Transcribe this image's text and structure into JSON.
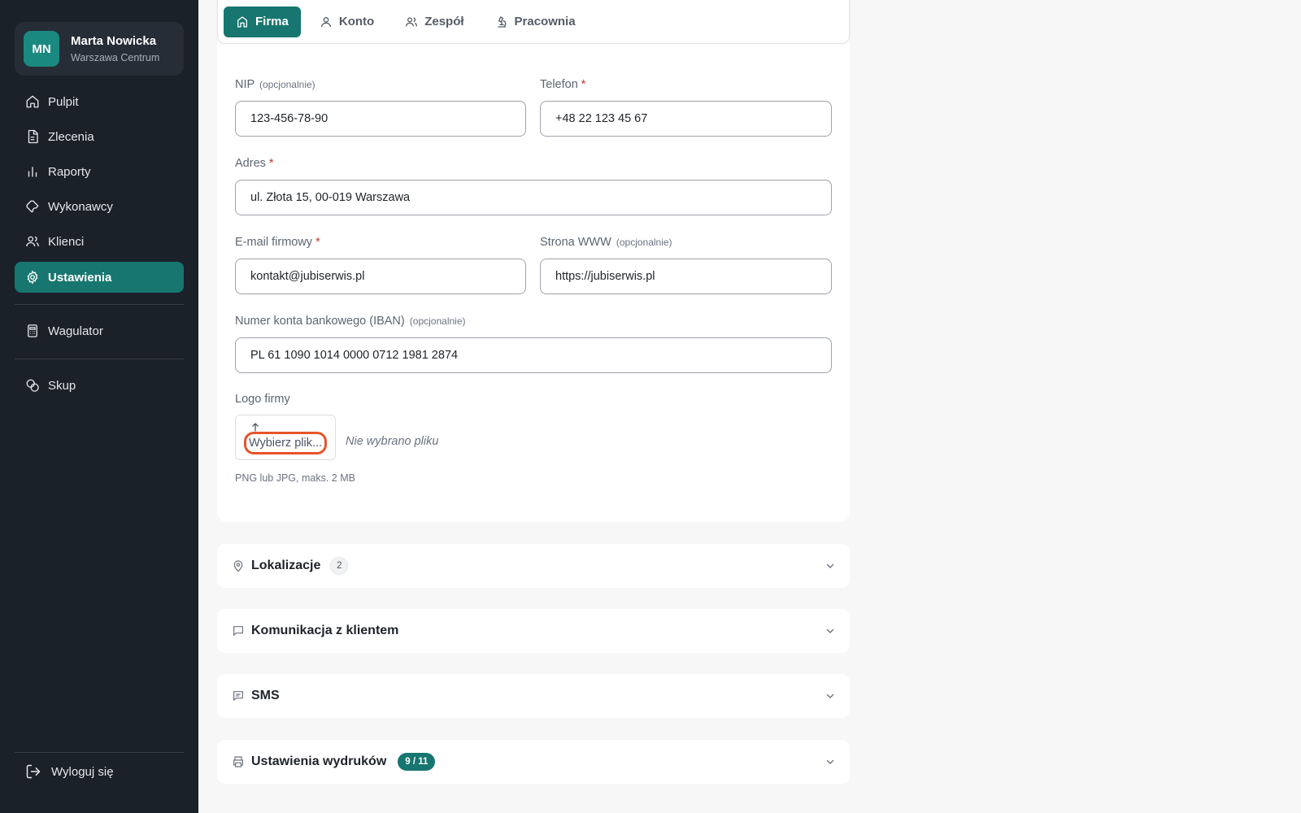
{
  "user": {
    "initials": "MN",
    "name": "Marta Nowicka",
    "location": "Warszawa Centrum"
  },
  "nav": {
    "items": [
      {
        "label": "Pulpit",
        "icon": "home-icon"
      },
      {
        "label": "Zlecenia",
        "icon": "document-icon"
      },
      {
        "label": "Raporty",
        "icon": "bar-chart-icon"
      },
      {
        "label": "Wykonawcy",
        "icon": "wrench-icon"
      },
      {
        "label": "Klienci",
        "icon": "users-icon"
      },
      {
        "label": "Ustawienia",
        "icon": "gear-icon",
        "active": true
      }
    ],
    "extra": [
      {
        "label": "Wagulator",
        "icon": "calculator-icon"
      },
      {
        "label": "Skup",
        "icon": "coins-icon"
      }
    ],
    "logout": "Wyloguj się"
  },
  "tabs": [
    {
      "label": "Firma",
      "icon": "building-icon",
      "active": true
    },
    {
      "label": "Konto",
      "icon": "user-icon"
    },
    {
      "label": "Zespół",
      "icon": "team-icon"
    },
    {
      "label": "Pracownia",
      "icon": "microscope-icon"
    }
  ],
  "form": {
    "nip": {
      "label": "NIP",
      "optional": "(opcjonalnie)",
      "value": "123-456-78-90"
    },
    "phone": {
      "label": "Telefon",
      "required": "*",
      "value": "+48 22 123 45 67"
    },
    "address": {
      "label": "Adres",
      "required": "*",
      "value": "ul. Złota 15, 00-019 Warszawa"
    },
    "email": {
      "label": "E-mail firmowy",
      "required": "*",
      "value": "kontakt@jubiserwis.pl"
    },
    "website": {
      "label": "Strona WWW",
      "optional": "(opcjonalnie)",
      "value": "https://jubiserwis.pl"
    },
    "iban": {
      "label": "Numer konta bankowego (IBAN)",
      "optional": "(opcjonalnie)",
      "value": "PL 61 1090 1014 0000 0712 1981 2874"
    },
    "logo": {
      "label": "Logo firmy",
      "button": "Wybierz plik...",
      "status": "Nie wybrano pliku",
      "hint": "PNG lub JPG, maks. 2 MB"
    }
  },
  "sections": [
    {
      "title": "Lokalizacje",
      "icon": "map-pin-icon",
      "badge": "2"
    },
    {
      "title": "Komunikacja z klientem",
      "icon": "chat-icon"
    },
    {
      "title": "SMS",
      "icon": "message-icon"
    },
    {
      "title": "Ustawienia wydruków",
      "icon": "printer-icon",
      "badge": "9 / 11"
    }
  ],
  "colors": {
    "sidebar": "#1b2129",
    "accent": "#17766f",
    "focus_ring": "#e8532a",
    "required": "#c0392b"
  }
}
